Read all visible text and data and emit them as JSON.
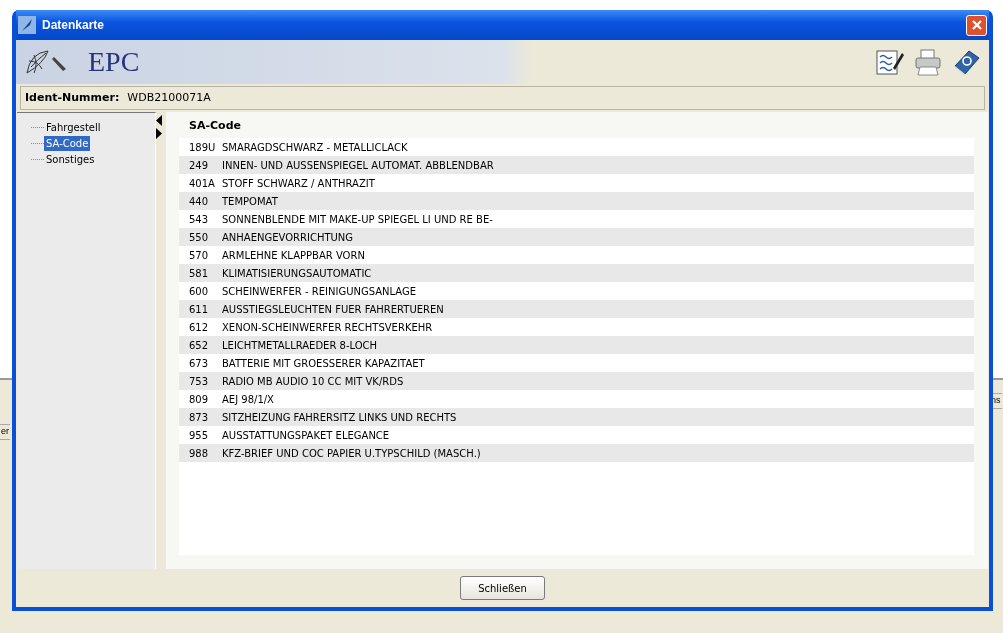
{
  "background": {
    "fragments": [
      "er",
      "ns"
    ]
  },
  "window": {
    "title": "Datenkarte"
  },
  "header": {
    "logo_text": "EPC"
  },
  "toolbar": [
    {
      "kind": "notes"
    },
    {
      "kind": "print"
    },
    {
      "kind": "help"
    }
  ],
  "ident": {
    "label": "Ident-Nummer:",
    "value": "WDB2100071A"
  },
  "tree": {
    "items": [
      {
        "label": "Fahrgestell",
        "selected": false
      },
      {
        "label": "SA-Code",
        "selected": true
      },
      {
        "label": "Sonstiges",
        "selected": false
      }
    ]
  },
  "content": {
    "title": "SA-Code",
    "rows": [
      {
        "code": "189U",
        "text": "SMARAGDSCHWARZ - METALLICLACK"
      },
      {
        "code": "249",
        "text": "INNEN- UND AUSSENSPIEGEL AUTOMAT. ABBLENDBAR"
      },
      {
        "code": "401A",
        "text": "STOFF SCHWARZ / ANTHRAZIT"
      },
      {
        "code": "440",
        "text": "TEMPOMAT"
      },
      {
        "code": "543",
        "text": "SONNENBLENDE MIT MAKE-UP SPIEGEL LI UND RE BE-"
      },
      {
        "code": "550",
        "text": "ANHAENGEVORRICHTUNG"
      },
      {
        "code": "570",
        "text": "ARMLEHNE KLAPPBAR VORN"
      },
      {
        "code": "581",
        "text": "KLIMATISIERUNGSAUTOMATIC"
      },
      {
        "code": "600",
        "text": "SCHEINWERFER - REINIGUNGSANLAGE"
      },
      {
        "code": "611",
        "text": "AUSSTIEGSLEUCHTEN FUER FAHRERTUEREN"
      },
      {
        "code": "612",
        "text": "XENON-SCHEINWERFER RECHTSVERKEHR"
      },
      {
        "code": "652",
        "text": "LEICHTMETALLRAEDER 8-LOCH"
      },
      {
        "code": "673",
        "text": "BATTERIE MIT GROESSERER KAPAZITAET"
      },
      {
        "code": "753",
        "text": "RADIO MB AUDIO 10 CC MIT VK/RDS"
      },
      {
        "code": "809",
        "text": "AEJ 98/1/X"
      },
      {
        "code": "873",
        "text": "SITZHEIZUNG FAHRERSITZ LINKS UND RECHTS"
      },
      {
        "code": "955",
        "text": "AUSSTATTUNGSPAKET ELEGANCE"
      },
      {
        "code": "988",
        "text": "KFZ-BRIEF UND COC PAPIER U.TYPSCHILD (MASCH.)"
      }
    ]
  },
  "buttons": [
    {
      "label": "Schließen"
    }
  ]
}
